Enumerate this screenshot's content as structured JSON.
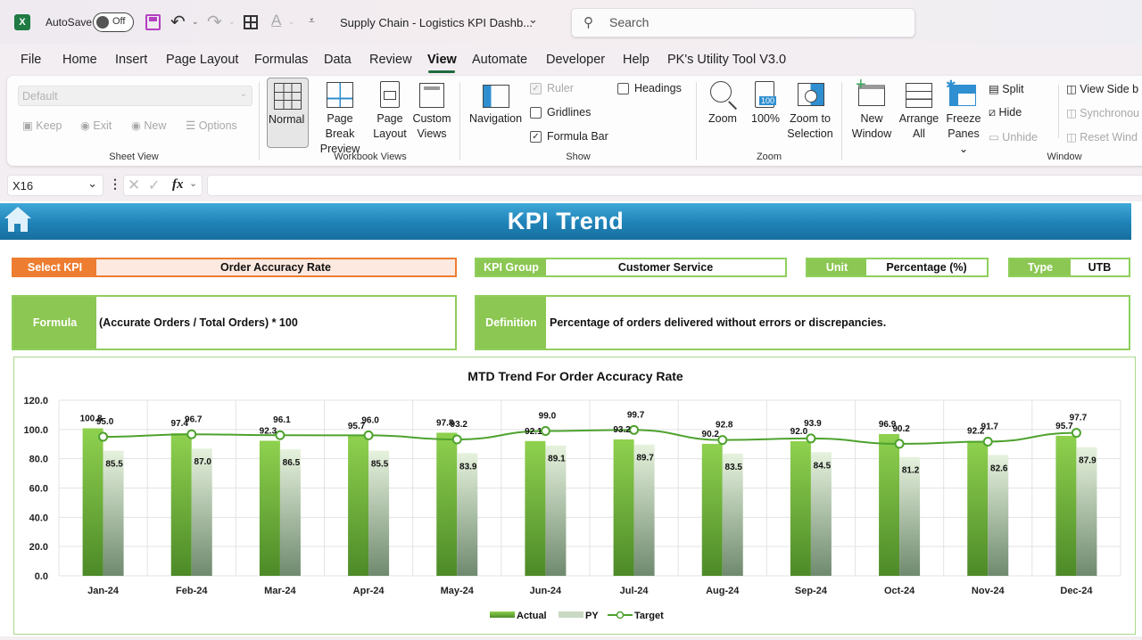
{
  "titlebar": {
    "autosave_label": "AutoSave",
    "autosave_state": "Off",
    "document_title": "Supply Chain - Logistics KPI Dashb...",
    "search_placeholder": "Search"
  },
  "menu": {
    "tabs": [
      "File",
      "Home",
      "Insert",
      "Page Layout",
      "Formulas",
      "Data",
      "Review",
      "View",
      "Automate",
      "Developer",
      "Help",
      "PK's Utility Tool V3.0"
    ],
    "active": "View"
  },
  "ribbon": {
    "sheet_view": {
      "dropdown_value": "Default",
      "keep": "Keep",
      "exit": "Exit",
      "new": "New",
      "options": "Options",
      "label": "Sheet View"
    },
    "workbook_views": {
      "normal": "Normal",
      "page_break_1": "Page Break",
      "page_break_2": "Preview",
      "page_layout_1": "Page",
      "page_layout_2": "Layout",
      "custom_views_1": "Custom",
      "custom_views_2": "Views",
      "label": "Workbook Views"
    },
    "show": {
      "navigation": "Navigation",
      "ruler": "Ruler",
      "ruler_checked": true,
      "gridlines": "Gridlines",
      "gridlines_checked": false,
      "formula_bar": "Formula Bar",
      "formula_bar_checked": true,
      "headings": "Headings",
      "headings_checked": false,
      "label": "Show"
    },
    "zoom": {
      "zoom": "Zoom",
      "hundred": "100%",
      "hundred_icon": "100",
      "zoom_sel_1": "Zoom to",
      "zoom_sel_2": "Selection",
      "label": "Zoom"
    },
    "window": {
      "new_window_1": "New",
      "new_window_2": "Window",
      "arrange_1": "Arrange",
      "arrange_2": "All",
      "freeze_1": "Freeze",
      "freeze_2": "Panes",
      "split": "Split",
      "hide": "Hide",
      "unhide": "Unhide",
      "view_side": "View Side b",
      "synchronous": "Synchronou",
      "reset": "Reset Wind",
      "label": "Window"
    }
  },
  "formula_bar": {
    "name_box": "X16",
    "fx": "fx",
    "value": ""
  },
  "dashboard": {
    "title": "KPI Trend",
    "select_kpi_label": "Select KPI",
    "select_kpi_value": "Order Accuracy Rate",
    "kpi_group_label": "KPI Group",
    "kpi_group_value": "Customer Service",
    "unit_label": "Unit",
    "unit_value": "Percentage (%)",
    "type_label": "Type",
    "type_value": "UTB",
    "formula_label": "Formula",
    "formula_value": "(Accurate Orders / Total Orders) * 100",
    "definition_label": "Definition",
    "definition_value": "Percentage of orders delivered without errors or discrepancies.",
    "colors": {
      "orange": "#ed7d31",
      "green": "#8bc752",
      "banner": "#1f82b7"
    }
  },
  "chart_data": {
    "type": "bar",
    "title": "MTD Trend For Order Accuracy Rate",
    "categories": [
      "Jan-24",
      "Feb-24",
      "Mar-24",
      "Apr-24",
      "May-24",
      "Jun-24",
      "Jul-24",
      "Aug-24",
      "Sep-24",
      "Oct-24",
      "Nov-24",
      "Dec-24"
    ],
    "series": [
      {
        "name": "Actual",
        "kind": "bar",
        "values": [
          100.8,
          97.4,
          92.3,
          95.7,
          97.8,
          92.1,
          93.2,
          90.2,
          92.0,
          96.9,
          92.2,
          95.7
        ]
      },
      {
        "name": "PY",
        "kind": "bar",
        "values": [
          85.5,
          87.0,
          86.5,
          85.5,
          83.9,
          89.1,
          89.7,
          83.5,
          84.5,
          81.2,
          82.6,
          87.9
        ]
      },
      {
        "name": "Target",
        "kind": "line",
        "values": [
          95.0,
          96.7,
          96.1,
          96.0,
          93.2,
          99.0,
          99.7,
          92.8,
          93.9,
          90.2,
          91.7,
          97.7
        ]
      }
    ],
    "y_ticks": [
      "0.0",
      "20.0",
      "40.0",
      "60.0",
      "80.0",
      "100.0",
      "120.0"
    ],
    "ylim": [
      0,
      120
    ],
    "xlabel": "",
    "ylabel": "",
    "grid": true,
    "legend": "bottom"
  }
}
